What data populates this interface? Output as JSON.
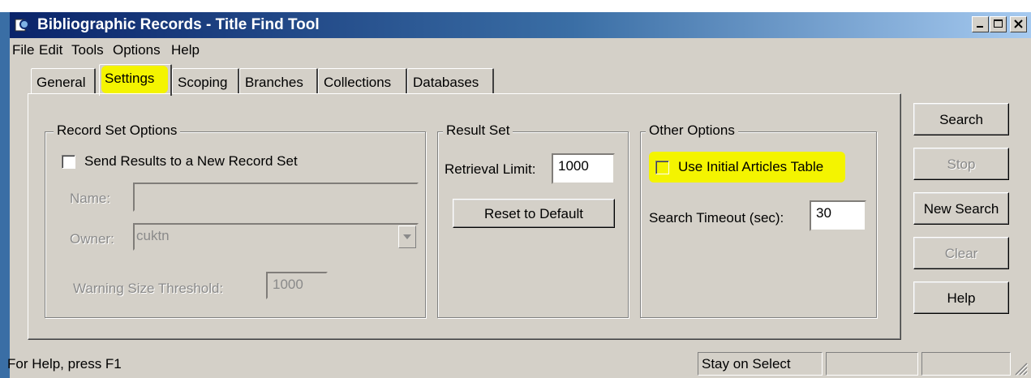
{
  "window": {
    "title": "Bibliographic Records - Title Find Tool",
    "icons": {
      "app": "search-records-icon",
      "minimize": "minimize-icon",
      "maximize": "maximize-icon",
      "close": "close-icon"
    }
  },
  "menu": [
    "File",
    "Edit",
    "Tools",
    "Options",
    "Help"
  ],
  "tabs": [
    "General",
    "Settings",
    "Scoping",
    "Branches",
    "Collections",
    "Databases"
  ],
  "active_tab": "Settings",
  "record_set_options": {
    "legend": "Record Set Options",
    "send_results_label": "Send Results to a New Record Set",
    "send_results_checked": false,
    "name_label": "Name:",
    "name_value": "",
    "owner_label": "Owner:",
    "owner_value": "cuktn",
    "warning_label": "Warning Size Threshold:",
    "warning_value": "1000"
  },
  "result_set": {
    "legend": "Result Set",
    "retrieval_label": "Retrieval Limit:",
    "retrieval_value": "1000",
    "reset_label": "Reset to Default"
  },
  "other_options": {
    "legend": "Other Options",
    "initial_articles_label": "Use Initial Articles Table",
    "initial_articles_checked": false,
    "timeout_label": "Search Timeout (sec):",
    "timeout_value": "30"
  },
  "buttons": {
    "search": "Search",
    "stop": "Stop",
    "new_search": "New Search",
    "clear": "Clear",
    "help": "Help"
  },
  "status": {
    "help_text": "For Help, press F1",
    "mode": "Stay on Select"
  },
  "colors": {
    "title_start": "#0a246a",
    "title_end": "#a6caf0",
    "window_bg": "#d4d0c8",
    "highlight": "#f4f400"
  }
}
